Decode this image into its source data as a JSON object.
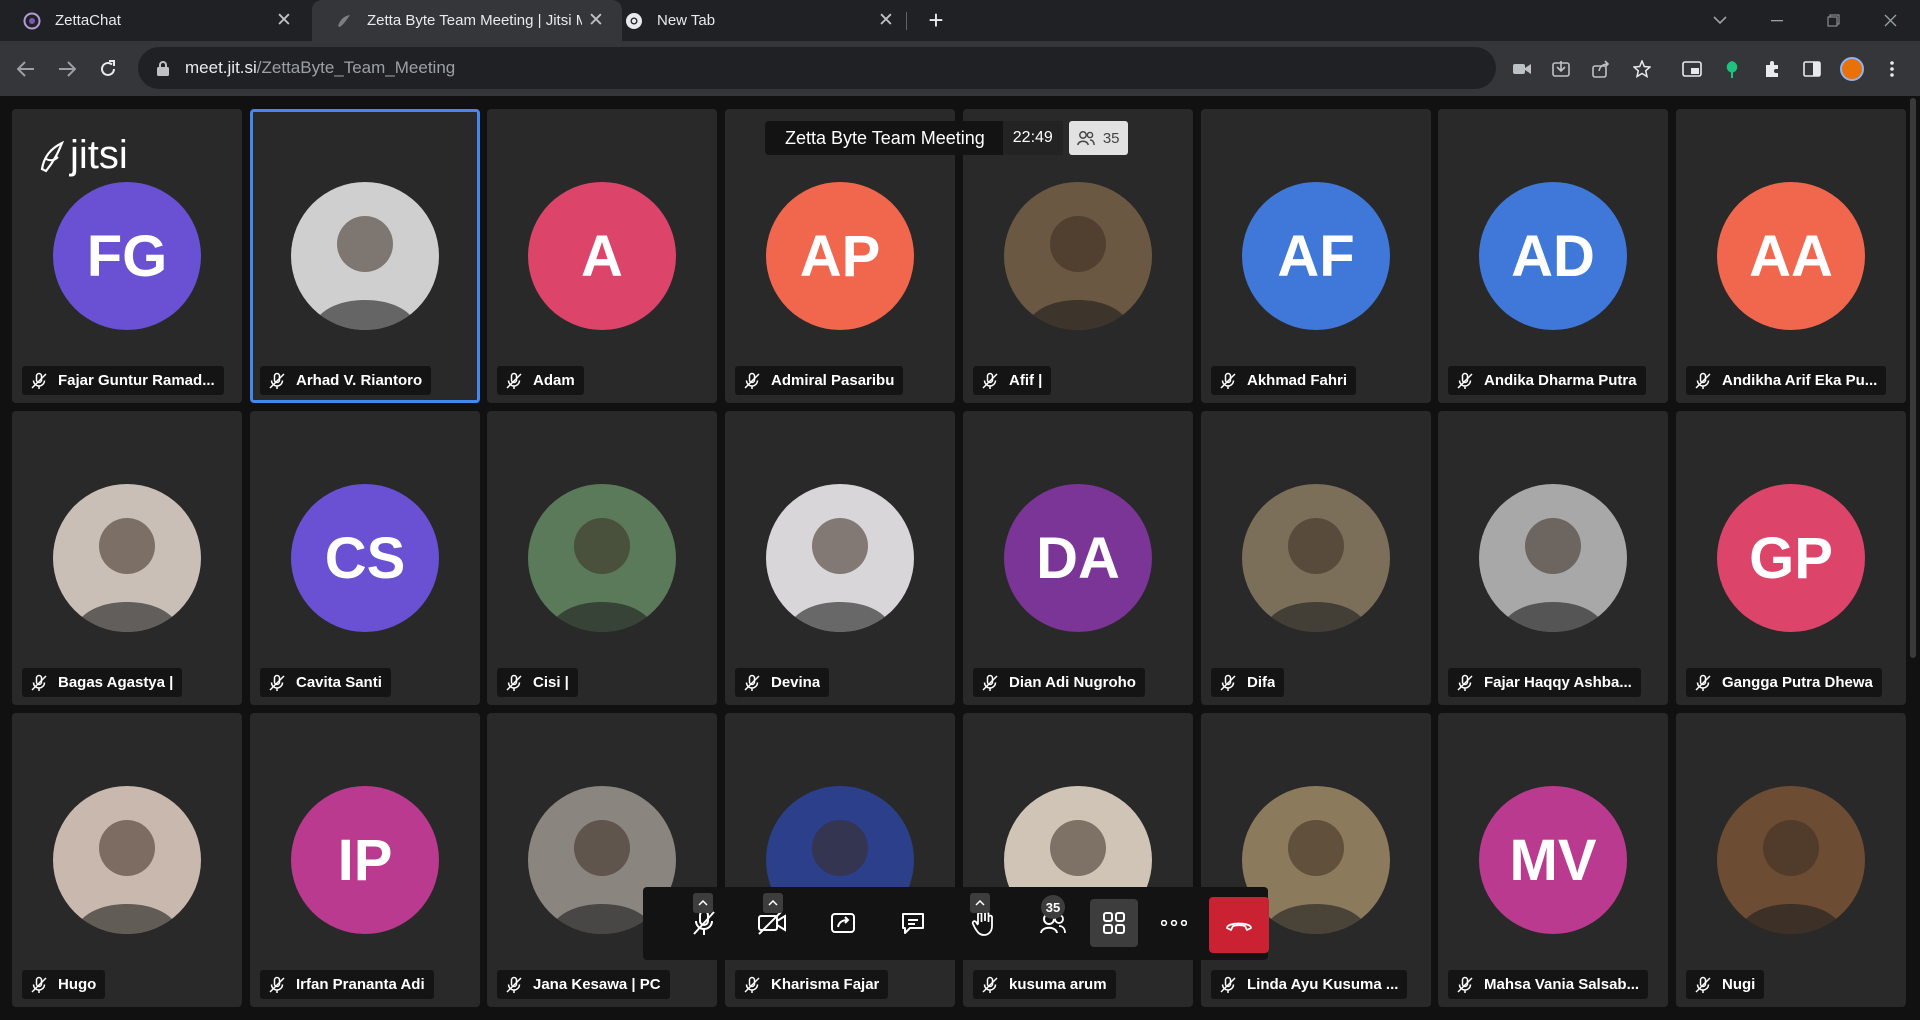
{
  "browser": {
    "tabs": [
      {
        "title": "ZettaChat",
        "icon": "zettachat-favicon",
        "active": false
      },
      {
        "title": "Zetta Byte Team Meeting | Jitsi Meet",
        "icon": "jitsi-favicon",
        "active": true
      },
      {
        "title": "New Tab",
        "icon": "chrome-favicon",
        "active": false
      }
    ],
    "url_host": "meet.jit.si",
    "url_path": "/ZettaByte_Team_Meeting"
  },
  "meeting": {
    "logo_text": "jitsi",
    "title": "Zetta Byte Team Meeting",
    "elapsed": "22:49",
    "participant_count": "35",
    "toolbox_badge": "35"
  },
  "participants": [
    {
      "name": "Fajar Guntur Ramad...",
      "initials": "FG",
      "color": "#6a50d3",
      "photo": false
    },
    {
      "name": "Arhad V. Riantoro",
      "initials": "",
      "color": "#cfcfcf",
      "photo": true,
      "dominant": true
    },
    {
      "name": "Adam",
      "initials": "A",
      "color": "#dd446a",
      "photo": false
    },
    {
      "name": "Admiral Pasaribu",
      "initials": "AP",
      "color": "#f0674e",
      "photo": false
    },
    {
      "name": "Afif |",
      "initials": "",
      "color": "#6b5842",
      "photo": true
    },
    {
      "name": "Akhmad Fahri",
      "initials": "AF",
      "color": "#3f78d8",
      "photo": false
    },
    {
      "name": "Andika Dharma Putra",
      "initials": "AD",
      "color": "#3f78d8",
      "photo": false
    },
    {
      "name": "Andikha Arif Eka Pu...",
      "initials": "AA",
      "color": "#f0674e",
      "photo": false
    },
    {
      "name": "Bagas Agastya |",
      "initials": "",
      "color": "#c9bfb6",
      "photo": true
    },
    {
      "name": "Cavita Santi",
      "initials": "CS",
      "color": "#6a50d3",
      "photo": false
    },
    {
      "name": "Cisi |",
      "initials": "",
      "color": "#5a7a5a",
      "photo": true
    },
    {
      "name": "Devina",
      "initials": "",
      "color": "#d8d6d8",
      "photo": true
    },
    {
      "name": "Dian Adi Nugroho",
      "initials": "DA",
      "color": "#7a3596",
      "photo": false
    },
    {
      "name": "Difa",
      "initials": "",
      "color": "#7b6f5a",
      "photo": true
    },
    {
      "name": "Fajar Haqqy Ashba...",
      "initials": "",
      "color": "#a8a8a8",
      "photo": true
    },
    {
      "name": "Gangga Putra Dhewa",
      "initials": "GP",
      "color": "#dd446a",
      "photo": false
    },
    {
      "name": "Hugo",
      "initials": "",
      "color": "#c9b8ad",
      "photo": true
    },
    {
      "name": "Irfan Prananta Adi",
      "initials": "IP",
      "color": "#b93a8e",
      "photo": false
    },
    {
      "name": "Jana Kesawa | PC",
      "initials": "",
      "color": "#8b8580",
      "photo": true
    },
    {
      "name": "Kharisma Fajar",
      "initials": "",
      "color": "#2b3f8a",
      "photo": true
    },
    {
      "name": "kusuma arum",
      "initials": "",
      "color": "#cfc4b5",
      "photo": true
    },
    {
      "name": "Linda Ayu Kusuma ...",
      "initials": "",
      "color": "#8c7a5c",
      "photo": true
    },
    {
      "name": "Mahsa Vania Salsab...",
      "initials": "MV",
      "color": "#b93a8e",
      "photo": false
    },
    {
      "name": "Nugi",
      "initials": "",
      "color": "#6c4c33",
      "photo": true
    }
  ]
}
